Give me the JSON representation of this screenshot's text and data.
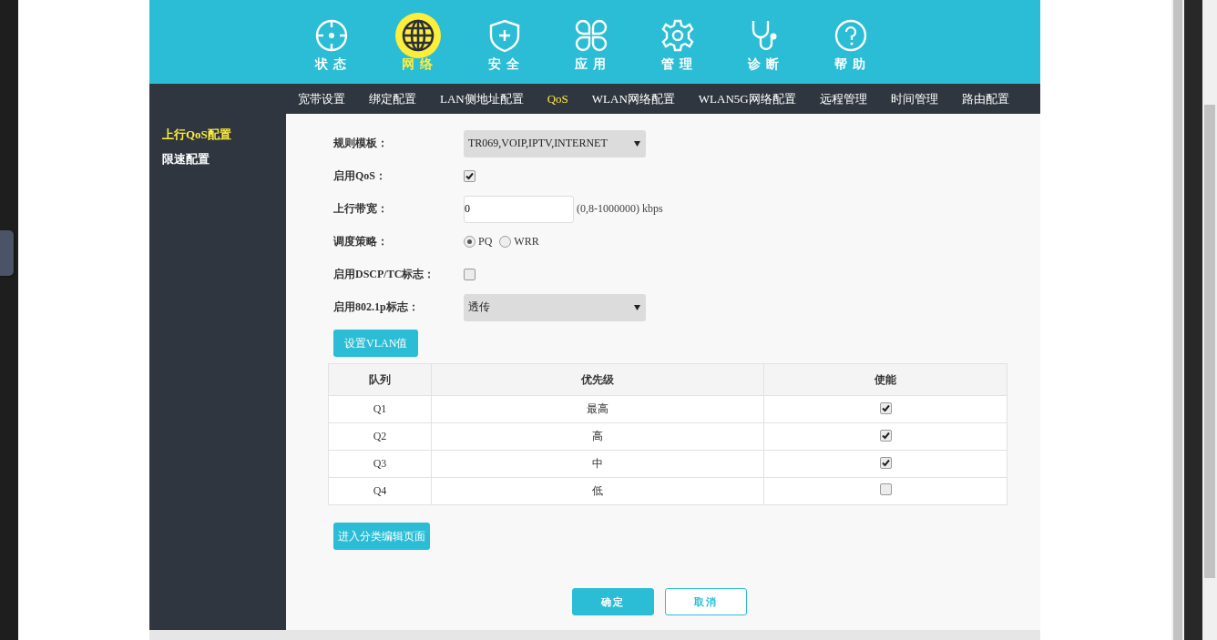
{
  "main_nav": [
    {
      "label": "状 态",
      "selected": false
    },
    {
      "label": "网 络",
      "selected": true
    },
    {
      "label": "安 全",
      "selected": false
    },
    {
      "label": "应 用",
      "selected": false
    },
    {
      "label": "管 理",
      "selected": false
    },
    {
      "label": "诊 断",
      "selected": false
    },
    {
      "label": "帮 助",
      "selected": false
    }
  ],
  "sub_nav": [
    {
      "label": "宽带设置",
      "selected": false
    },
    {
      "label": "绑定配置",
      "selected": false
    },
    {
      "label": "LAN侧地址配置",
      "selected": false
    },
    {
      "label": "QoS",
      "selected": true
    },
    {
      "label": "WLAN网络配置",
      "selected": false
    },
    {
      "label": "WLAN5G网络配置",
      "selected": false
    },
    {
      "label": "远程管理",
      "selected": false
    },
    {
      "label": "时间管理",
      "selected": false
    },
    {
      "label": "路由配置",
      "selected": false
    }
  ],
  "sidebar": {
    "items": [
      {
        "label": "上行QoS配置",
        "selected": true
      },
      {
        "label": "限速配置",
        "selected": false
      }
    ]
  },
  "form": [
    {
      "kind": "select",
      "label": "规则模板：",
      "value": "TR069,VOIP,IPTV,INTERNET"
    },
    {
      "kind": "checkbox",
      "label": "启用QoS：",
      "checked": true
    },
    {
      "kind": "input",
      "label": "上行带宽：",
      "value": "0",
      "hint": "(0,8-1000000) kbps"
    },
    {
      "kind": "radio",
      "label": "调度策略：",
      "options": [
        {
          "label": "PQ",
          "selected": true
        },
        {
          "label": "WRR",
          "selected": false
        }
      ]
    },
    {
      "kind": "checkbox",
      "label": "启用DSCP/TC标志：",
      "checked": false
    },
    {
      "kind": "select",
      "label": "启用802.1p标志：",
      "value": "透传"
    }
  ],
  "vlan_button": "设置VLAN值",
  "table": {
    "columns": [
      "队列",
      "优先级",
      "使能"
    ],
    "rows": [
      {
        "queue": "Q1",
        "priority": "最高",
        "enabled": true
      },
      {
        "queue": "Q2",
        "priority": "高",
        "enabled": true
      },
      {
        "queue": "Q3",
        "priority": "中",
        "enabled": true
      },
      {
        "queue": "Q4",
        "priority": "低",
        "enabled": false
      }
    ]
  },
  "classify_button": "进入分类编辑页面",
  "buttons": [
    {
      "kind": "primary",
      "label": "确定"
    },
    {
      "kind": "secondary",
      "label": "取消"
    }
  ]
}
